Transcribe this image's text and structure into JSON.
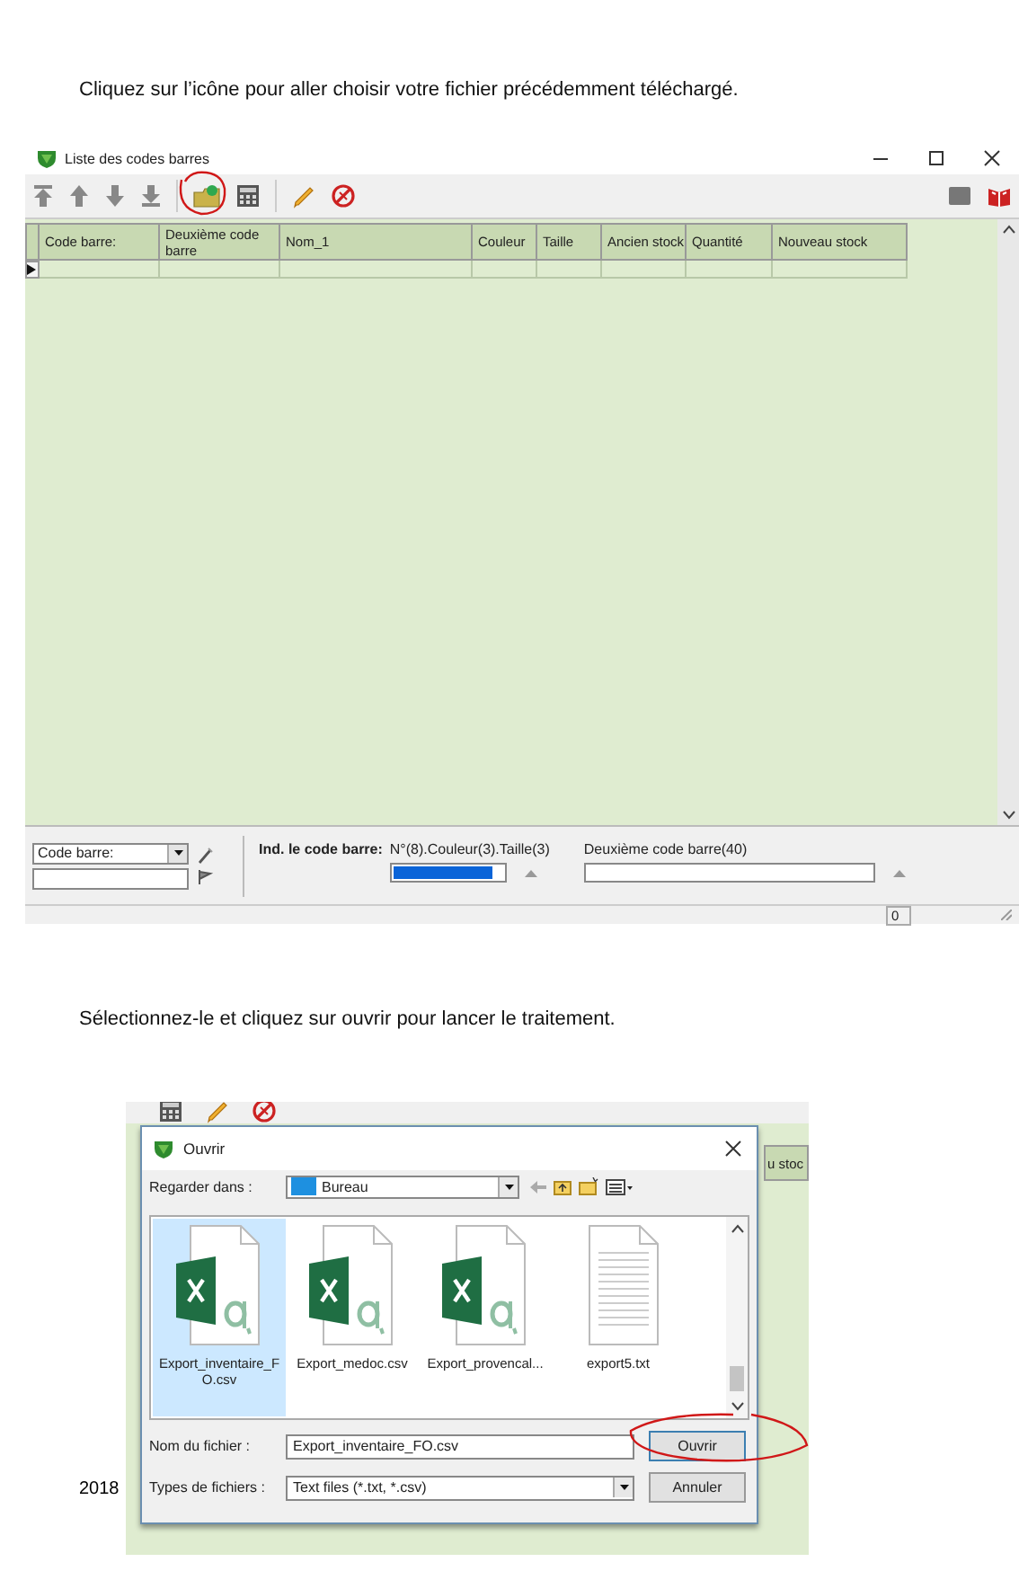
{
  "step_1_text": "Cliquez sur l’icône pour aller choisir votre fichier précédemment téléchargé.",
  "window": {
    "title": "Liste des codes barres",
    "table": {
      "columns": [
        "Code barre:",
        "Deuxième code barre",
        "Nom_1",
        "Couleur",
        "Taille",
        "Ancien stock",
        "Quantité",
        "Nouveau stock"
      ],
      "rows": [
        {
          "current": true
        }
      ]
    },
    "bottom_panel": {
      "search_by": "Code barre:",
      "label": "Ind. le code barre:",
      "fields": [
        {
          "label": "N°(8).Couleur(3).Taille(3)",
          "selected": true
        },
        {
          "label": "Deuxième code barre(40)",
          "selected": false
        }
      ]
    },
    "status_bar": {
      "count": "0"
    }
  },
  "step_2_text": "Sélectionnez-le et cliquez sur ouvrir pour lancer le traitement.",
  "footer_year": "2018",
  "screenshot_2": {
    "background_header_fragment": "u stoc",
    "dialog": {
      "title": "Ouvrir",
      "look_in_label": "Regarder dans :",
      "look_in_value": "Bureau",
      "files": [
        {
          "name": "Export_inventaire_FO.csv",
          "kind": "excel",
          "selected": true
        },
        {
          "name": "Export_medoc.csv",
          "kind": "excel",
          "selected": false
        },
        {
          "name": "Export_provencal...",
          "kind": "excel",
          "selected": false
        },
        {
          "name": "export5.txt",
          "kind": "text",
          "selected": false
        }
      ],
      "file_name_label": "Nom du fichier :",
      "file_name_value": "Export_inventaire_FO.csv",
      "file_type_label": "Types de fichiers :",
      "file_type_value": "Text files (*.txt, *.csv)",
      "buttons": [
        "Ouvrir",
        "Annuler"
      ]
    }
  }
}
